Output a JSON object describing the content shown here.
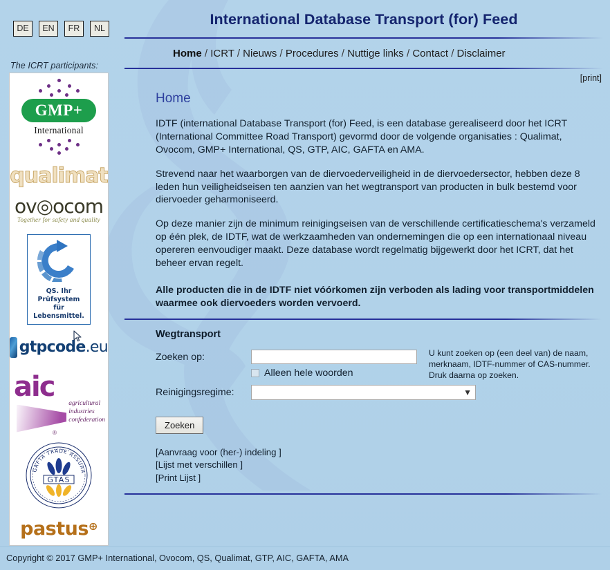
{
  "languages": [
    {
      "code": "DE"
    },
    {
      "code": "EN"
    },
    {
      "code": "FR"
    },
    {
      "code": "NL"
    }
  ],
  "sidebar": {
    "participants_label": "The ICRT participants:",
    "logos": [
      {
        "name": "gmp-plus-international",
        "main": "GMP+",
        "sub": "International"
      },
      {
        "name": "qualimat",
        "main": "qualimat"
      },
      {
        "name": "ovocom",
        "main": "ov◎ocom",
        "tag": "Together for safety and quality"
      },
      {
        "name": "qs",
        "line1": "QS. Ihr Prüfsystem",
        "line2": "für Lebensmittel."
      },
      {
        "name": "gtpcode",
        "main": "gtpcode",
        "suffix": ".eu"
      },
      {
        "name": "aic",
        "main": "aic",
        "sub1": "agricultural",
        "sub2": "industries",
        "sub3": "confederation",
        "mark": "®"
      },
      {
        "name": "gtas",
        "ring": "GAFTA TRADE ASSURANCE SCHEME",
        "center": "GTAS"
      },
      {
        "name": "pastus",
        "main": "pastus",
        "sup": "⊕"
      }
    ]
  },
  "header": {
    "title": "International Database Transport (for) Feed",
    "print_label": "[print]",
    "nav": [
      {
        "label": "Home",
        "active": true
      },
      {
        "label": "ICRT",
        "active": false
      },
      {
        "label": "Nieuws",
        "active": false
      },
      {
        "label": "Procedures",
        "active": false
      },
      {
        "label": "Nuttige links",
        "active": false
      },
      {
        "label": "Contact",
        "active": false
      },
      {
        "label": "Disclaimer",
        "active": false
      }
    ],
    "nav_separator": "/"
  },
  "content": {
    "heading": "Home",
    "paragraphs": [
      "IDTF (international Database Transport (for) Feed, is een database gerealiseerd door het ICRT (International Committee Road Transport) gevormd door de volgende organisaties : Qualimat, Ovocom, GMP+ International, QS, GTP, AIC, GAFTA en AMA.",
      "Strevend naar het waarborgen van de diervoederveiligheid in de diervoedersector, hebben deze 8 leden hun veiligheidseisen ten aanzien van  het  wegtransport van producten in bulk bestemd voor diervoeder geharmoniseerd.",
      "Op deze manier zijn de minimum reinigingseisen van de verschillende certificatieschema's verzameld op één plek, de IDTF, wat de werkzaamheden van ondernemingen die op een internationaal niveau opereren eenvoudiger maakt. Deze database wordt regelmatig bijgewerkt door het ICRT, dat het beheer ervan regelt."
    ],
    "bold_paragraph": "Alle producten die in de IDTF niet vóórkomen zijn verboden als lading voor transportmiddelen waarmee ook diervoeders worden vervoerd."
  },
  "form": {
    "title": "Wegtransport",
    "search_label": "Zoeken op:",
    "search_value": "",
    "search_placeholder": "",
    "whole_words_label": "Alleen hele woorden",
    "whole_words_checked": false,
    "regime_label": "Reinigingsregime:",
    "regime_value": "",
    "regime_options": [
      ""
    ],
    "hint": "U kunt zoeken op (een deel van) de naam, merknaam, IDTF-nummer of CAS-nummer. Druk daarna op zoeken.",
    "submit_label": "Zoeken"
  },
  "bottom_links": [
    "[Aanvraag voor (her-) indeling ]",
    "[Lijst met verschillen ]",
    "[Print Lijst ]"
  ],
  "footer": {
    "copyright": "Copyright © 2017 GMP+ International, Ovocom, QS, Qualimat, GTP, AIC, GAFTA, AMA"
  },
  "colors": {
    "page_bg": "#b1d2e9",
    "title_blue": "#14246e",
    "rule_blue": "#27319a",
    "heading_blue": "#2d3f9e",
    "gmp_green": "#1d9e4c",
    "aic_purple": "#8e2d8e",
    "pastus_orange": "#b5701a"
  }
}
